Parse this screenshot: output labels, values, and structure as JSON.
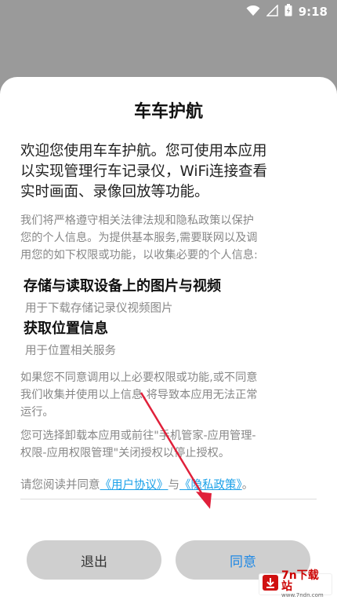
{
  "status": {
    "time": "9:18",
    "icons": [
      "wifi-icon",
      "signal-icon",
      "battery-icon"
    ]
  },
  "dialog": {
    "title": "车车护航",
    "lead_lines": [
      "欢迎您使用车车护航。您可使用本应用",
      "以实现管理行车记录仪，WiFi连接查看",
      "实时画面、录像回放等功能。"
    ],
    "intro_lines": [
      "我们将严格遵守相关法律法规和隐私政策以保护",
      "您的个人信息。为提供基本服务,需要联网以及调",
      "用您的如下权限或功能，以收集必要的个人信息:"
    ],
    "permissions": [
      {
        "title": "存储与读取设备上的图片与视频",
        "desc": "用于下载存储记录仪视频图片"
      },
      {
        "title": "获取位置信息",
        "desc": "用于位置相关服务"
      }
    ],
    "refuse_lines": [
      "如果您不同意调用以上必要权限或功能,或不同意",
      "我们收集并使用以上信息,将导致本应用无法正常",
      "运行。"
    ],
    "uninstall_lines": [
      "您可选择卸载本应用或前往\"手机管家-应用管理-",
      "权限-应用权限管理\"关闭授权以停止授权。"
    ],
    "agree": {
      "prefix": "请您阅读并同意",
      "user_agreement": "《用户协议》",
      "conj": "与",
      "privacy_policy": "《隐私政策》",
      "suffix": "。"
    },
    "buttons": {
      "exit": "退出",
      "agree": "同意"
    }
  },
  "watermark": {
    "text": "7n下载站",
    "url": "www.7ndn.com"
  },
  "colors": {
    "link": "#1aa0e8",
    "agree_text": "#1e88e5",
    "arrow": "#e0203a"
  }
}
